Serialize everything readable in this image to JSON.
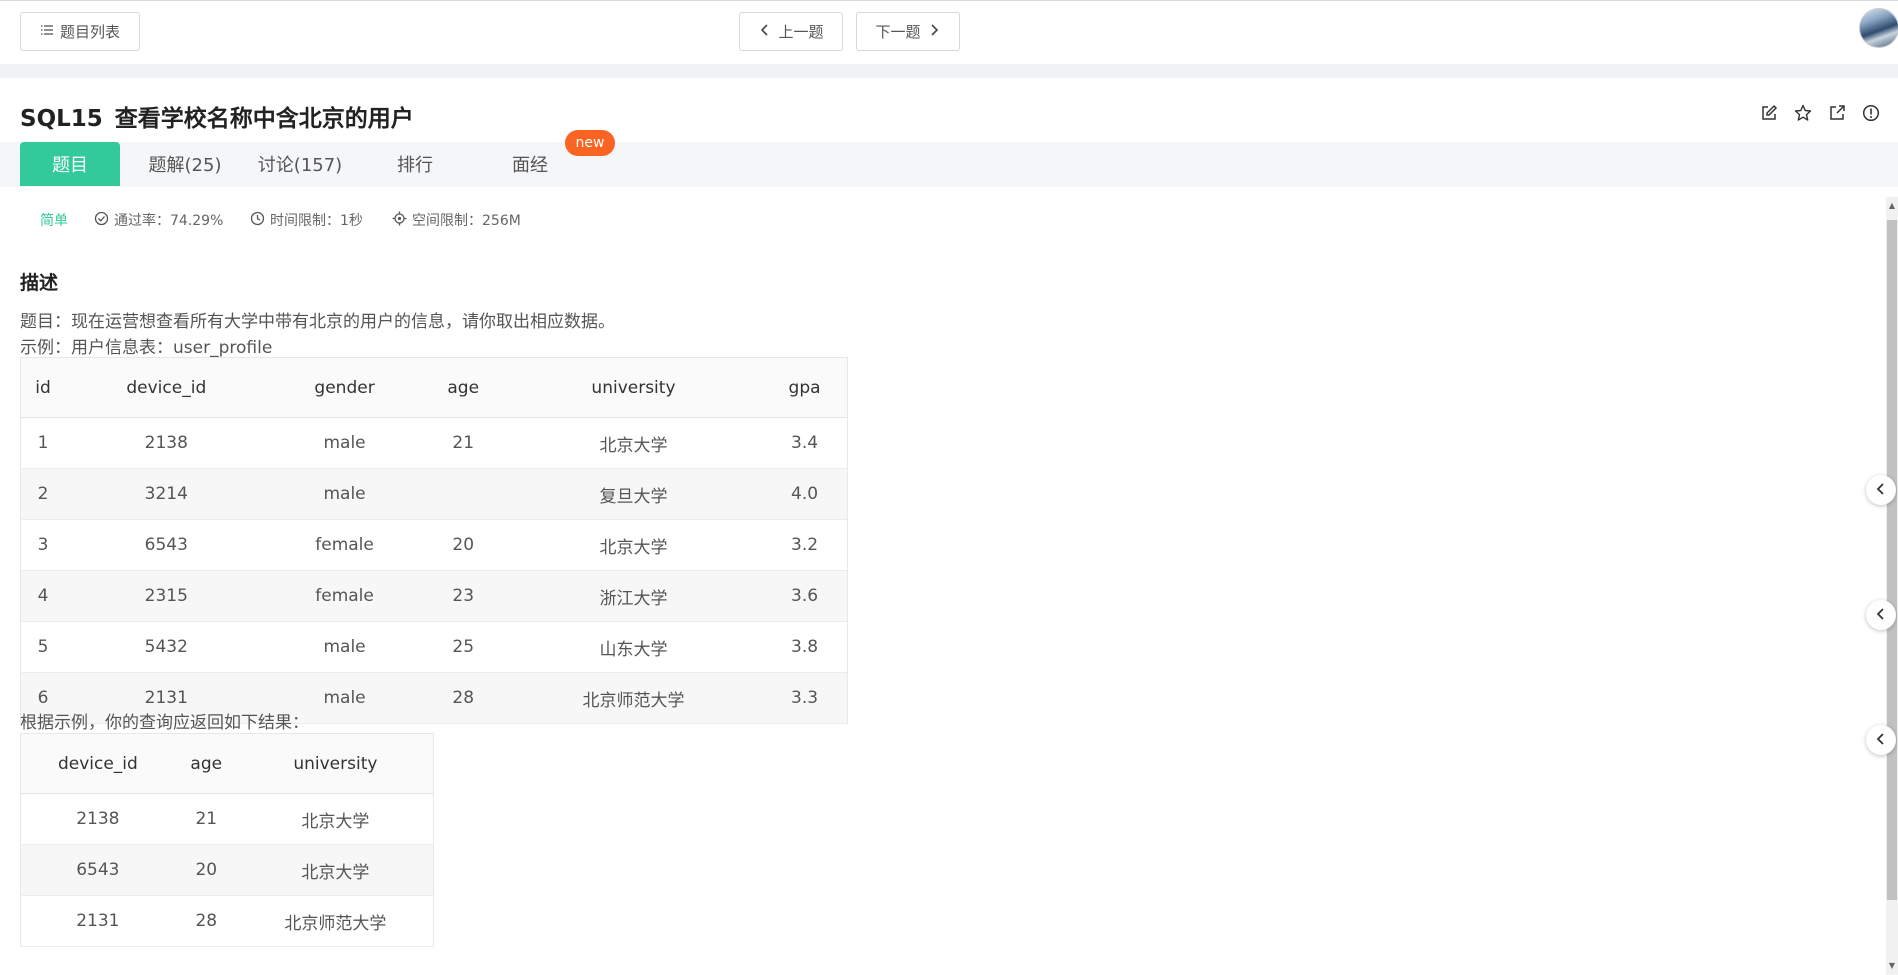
{
  "topbar": {
    "problem_list_label": "题目列表",
    "prev_label": "上一题",
    "next_label": "下一题"
  },
  "problem": {
    "code": "SQL15",
    "title": "查看学校名称中含北京的用户"
  },
  "tabs": [
    {
      "label": "题目",
      "active": true
    },
    {
      "label": "题解(25)"
    },
    {
      "label": "讨论(157)"
    },
    {
      "label": "排行"
    },
    {
      "label": "面经"
    }
  ],
  "new_badge": "new",
  "meta": {
    "difficulty": "简单",
    "pass_rate": "通过率：74.29%",
    "time_limit": "时间限制：1秒",
    "memory_limit": "空间限制：256M"
  },
  "description": {
    "heading": "描述",
    "line1": "题目：现在运营想查看所有大学中带有北京的用户的信息，请你取出相应数据。",
    "line2": "示例：用户信息表：user_profile",
    "result_intro": "根据示例，你的查询应返回如下结果："
  },
  "example_table": {
    "columns": [
      "id",
      "device_id",
      "gender",
      "age",
      "university",
      "gpa"
    ],
    "rows": [
      [
        "1",
        "2138",
        "male",
        "21",
        "北京大学",
        "3.4"
      ],
      [
        "2",
        "3214",
        "male",
        "",
        "复旦大学",
        "4.0"
      ],
      [
        "3",
        "6543",
        "female",
        "20",
        "北京大学",
        "3.2"
      ],
      [
        "4",
        "2315",
        "female",
        "23",
        "浙江大学",
        "3.6"
      ],
      [
        "5",
        "5432",
        "male",
        "25",
        "山东大学",
        "3.8"
      ],
      [
        "6",
        "2131",
        "male",
        "28",
        "北京师范大学",
        "3.3"
      ]
    ]
  },
  "result_table": {
    "columns": [
      "device_id",
      "age",
      "university"
    ],
    "rows": [
      [
        "2138",
        "21",
        "北京大学"
      ],
      [
        "6543",
        "20",
        "北京大学"
      ],
      [
        "2131",
        "28",
        "北京师范大学"
      ]
    ]
  },
  "colors": {
    "accent": "#32ca99",
    "new_badge": "#fa6423"
  },
  "icons": [
    "list-icon",
    "chevron-left-icon",
    "chevron-right-icon",
    "edit-icon",
    "star-icon",
    "share-icon",
    "info-icon",
    "check-circle-icon",
    "clock-icon",
    "memory-icon"
  ]
}
